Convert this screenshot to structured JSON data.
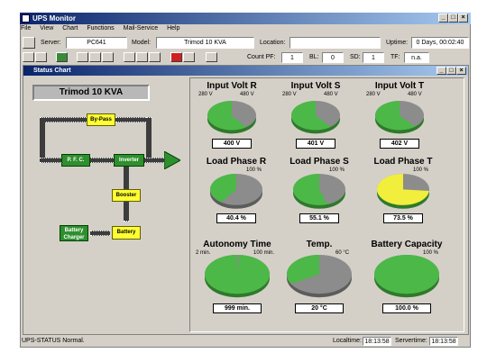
{
  "app": {
    "title": "UPS Monitor"
  },
  "menu": [
    "File",
    "View",
    "Chart",
    "Functions",
    "Mail-Service",
    "Help"
  ],
  "info": {
    "server_label": "Server:",
    "server_value": "PC641",
    "model_label": "Model:",
    "model_value": "Trimod 10 KVA",
    "location_label": "Location:",
    "location_value": "",
    "uptime_label": "Uptime:",
    "uptime_value": "0 Days, 00:02:40"
  },
  "counters": {
    "countpf_label": "Count PF:",
    "countpf_value": "1",
    "bl_label": "BL:",
    "bl_value": "0",
    "sd_label": "SD:",
    "sd_value": "1",
    "tf_label": "TF:",
    "tf_value": "n.a."
  },
  "status_chart": {
    "title": "Status Chart",
    "model": "Trimod 10 KVA",
    "blocks": {
      "bypass": "By-Pass",
      "pfc": "P. F. C.",
      "inverter": "Inverter",
      "booster": "Booster",
      "battery": "Battery",
      "charger": "Battery Charger"
    }
  },
  "colors": {
    "green": "#4cb848",
    "grey": "#8c8c8c",
    "yellow": "#f2ee3c"
  },
  "gauges": [
    {
      "title": "Input Volt R",
      "min_label": "280 V",
      "max_label": "480 V",
      "value_text": "400 V",
      "fraction": 0.6,
      "color": "green"
    },
    {
      "title": "Input Volt S",
      "min_label": "280 V",
      "max_label": "480 V",
      "value_text": "401 V",
      "fraction": 0.605,
      "color": "green"
    },
    {
      "title": "Input Volt T",
      "min_label": "280 V",
      "max_label": "480 V",
      "value_text": "402 V",
      "fraction": 0.61,
      "color": "green"
    },
    {
      "title": "Load Phase R",
      "min_label": "",
      "max_label": "100 %",
      "value_text": "40.4 %",
      "fraction": 0.404,
      "color": "green"
    },
    {
      "title": "Load Phase S",
      "min_label": "",
      "max_label": "100 %",
      "value_text": "55.1 %",
      "fraction": 0.551,
      "color": "green"
    },
    {
      "title": "Load Phase T",
      "min_label": "",
      "max_label": "100 %",
      "value_text": "73.5 %",
      "fraction": 0.735,
      "color": "yellow"
    },
    {
      "title": "Autonomy Time",
      "min_label": "2 min.",
      "max_label": "100 min.",
      "value_text": "999 min.",
      "fraction": 0.99,
      "color": "green"
    },
    {
      "title": "Temp.",
      "min_label": "",
      "max_label": "60 °C",
      "value_text": "20 °C",
      "fraction": 0.333,
      "color": "green"
    },
    {
      "title": "Battery Capacity",
      "min_label": "",
      "max_label": "100 %",
      "value_text": "100.0 %",
      "fraction": 1.0,
      "color": "green"
    }
  ],
  "statusbar": {
    "message": "UPS-STATUS Normal.",
    "localtime_label": "Localtime:",
    "localtime_value": "18:13:58",
    "servertime_label": "Servertime:",
    "servertime_value": "18:13:58"
  }
}
